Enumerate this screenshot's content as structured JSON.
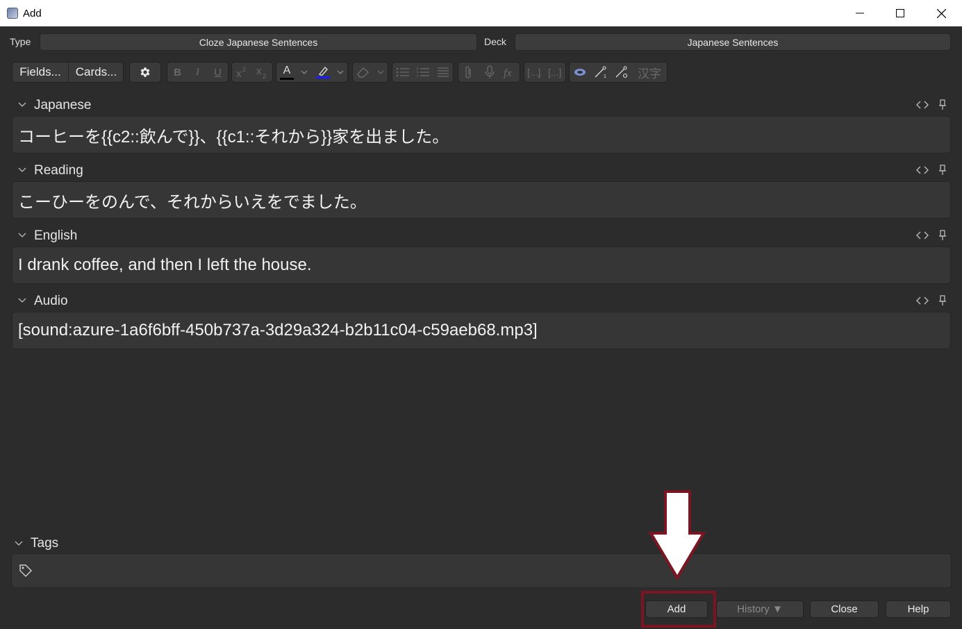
{
  "window": {
    "title": "Add"
  },
  "note_type": {
    "label": "Type",
    "value": "Cloze Japanese Sentences"
  },
  "deck": {
    "label": "Deck",
    "value": "Japanese Sentences"
  },
  "toolbar": {
    "fields_label": "Fields...",
    "cards_label": "Cards...",
    "bold": "B",
    "italic": "I",
    "underline": "U",
    "text_color": "A",
    "kanji_label": "汉字",
    "text_color_swatch": "#000000",
    "highlight_color_swatch": "#1a1aff"
  },
  "fields": [
    {
      "name": "Japanese",
      "value": "コーヒーを{{c2::飲んで}}、{{c1::それから}}家を出ました。"
    },
    {
      "name": "Reading",
      "value": "こーひーをのんで、それからいえをでました。"
    },
    {
      "name": "English",
      "value": "I drank coffee, and then I left the house."
    },
    {
      "name": "Audio",
      "value": "[sound:azure-1a6f6bff-450b737a-3d29a324-b2b11c04-c59aeb68.mp3]"
    }
  ],
  "tags": {
    "label": "Tags"
  },
  "buttons": {
    "add": "Add",
    "history": "History ▼",
    "close": "Close",
    "help": "Help"
  },
  "colors": {
    "background": "#2c2c2c",
    "annotation": "#7b1522"
  }
}
